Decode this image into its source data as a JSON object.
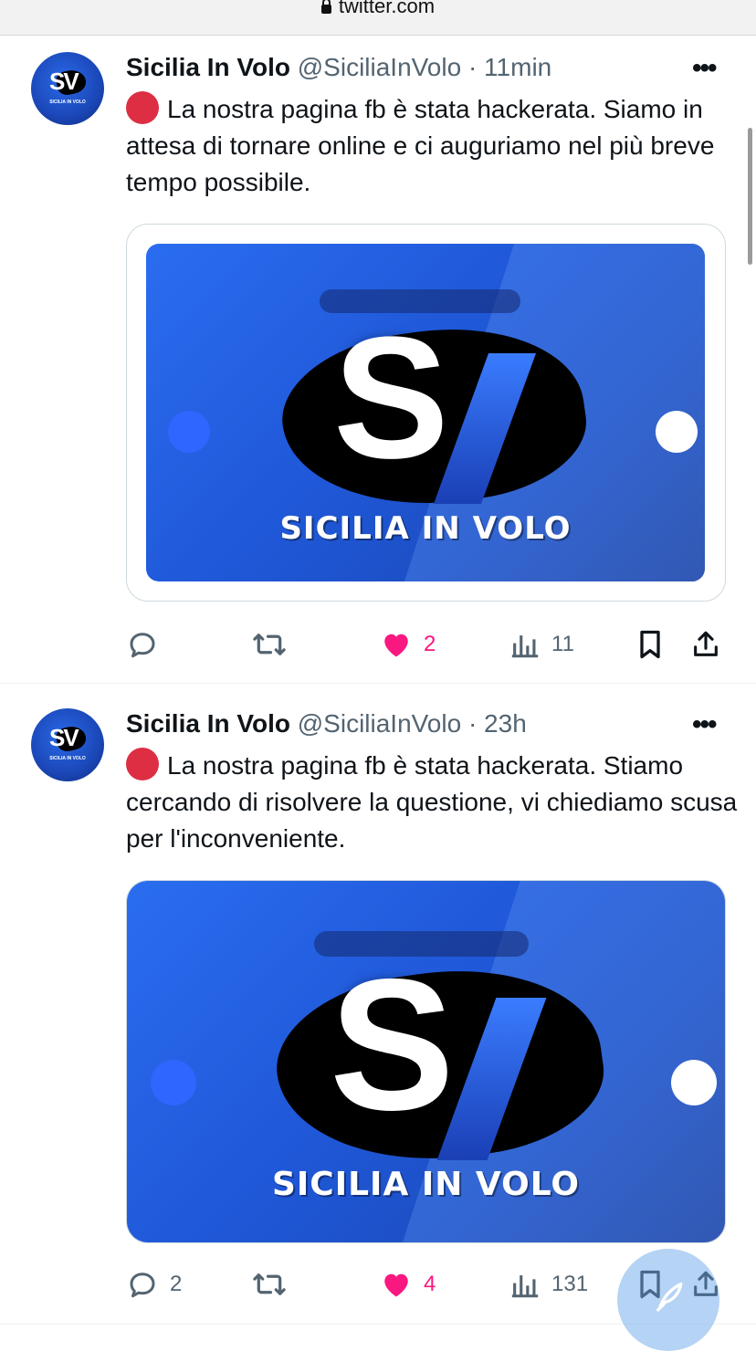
{
  "browser": {
    "url": "twitter.com"
  },
  "tweets": [
    {
      "name": "Sicilia In Volo",
      "handle": "@SiciliaInVolo",
      "sep": "·",
      "time": "11min",
      "text": "La nostra pagina fb è stata hackerata. Siamo in attesa di tornare online e ci auguriamo nel più breve tempo possibile.",
      "media_caption": "SICILIA IN VOLO",
      "stats": {
        "replies": "",
        "retweets": "",
        "likes": "2",
        "views": "11"
      }
    },
    {
      "name": "Sicilia In Volo",
      "handle": "@SiciliaInVolo",
      "sep": "·",
      "time": "23h",
      "text": "La nostra pagina fb è stata hackerata. Stiamo cercando di risolvere la questione, vi chiediamo scusa per l'inconveniente.",
      "media_caption": "SICILIA IN VOLO",
      "stats": {
        "replies": "2",
        "retweets": "",
        "likes": "4",
        "views": "131"
      }
    }
  ],
  "avatar": {
    "letters": "SV",
    "small_text": "SICILIA IN VOLO"
  },
  "media_logo": {
    "letter": "S"
  },
  "more_label": "•••",
  "colors": {
    "like": "#f91880",
    "text": "#0f1419",
    "muted": "#536471",
    "red_dot": "#dd2e44",
    "fab": "#78afeb"
  },
  "icons": [
    "lock-icon",
    "reply-icon",
    "retweet-icon",
    "heart-icon",
    "views-icon",
    "bookmark-icon",
    "share-icon",
    "compose-icon",
    "more-icon"
  ]
}
